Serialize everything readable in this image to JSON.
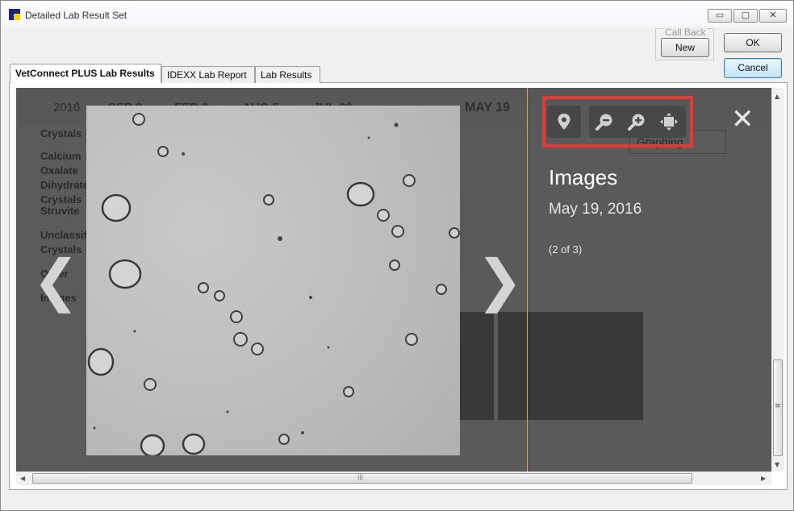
{
  "window": {
    "title": "Detailed Lab Result Set",
    "controls": {
      "minimize": "▭",
      "maximize": "▢",
      "close": "✕"
    }
  },
  "actions": {
    "callback_label": "Call Back",
    "new_label": "New",
    "ok_label": "OK",
    "cancel_label": "Cancel"
  },
  "tabs": [
    {
      "label": "VetConnect PLUS Lab Results",
      "active": true
    },
    {
      "label": "IDEXX Lab Report",
      "active": false
    },
    {
      "label": "Lab Results",
      "active": false
    }
  ],
  "background": {
    "dates": [
      "2016",
      "SEP 2",
      "FEB 2",
      "AUG 5",
      "JUL 20",
      "MAY 19"
    ],
    "sidebar_items": [
      "Crystals",
      "Calcium Oxalate Dihydrate Crystals",
      "Struvite",
      "Unclassified Crystals",
      "Other",
      "Images"
    ],
    "graphing_label": "Graphing"
  },
  "viewer": {
    "prev_arrow": "❮",
    "next_arrow": "❯",
    "close_symbol": "✕",
    "title": "Images",
    "date": "May 19, 2016",
    "counter": "(2 of 3)",
    "tools": [
      "location-pin-icon",
      "zoom-out-icon",
      "zoom-in-icon",
      "fit-screen-icon"
    ]
  },
  "scrollbars": {
    "vertical_up": "▲",
    "vertical_down": "▼",
    "vertical_grip": "≡",
    "horizontal_left": "◀",
    "horizontal_right": "▶",
    "horizontal_grip": "|||"
  },
  "colors": {
    "viewer_bg": "#2d2d2d",
    "divider": "#e6a23c",
    "highlight": "#e53935",
    "toolbar_group": "#474747"
  }
}
